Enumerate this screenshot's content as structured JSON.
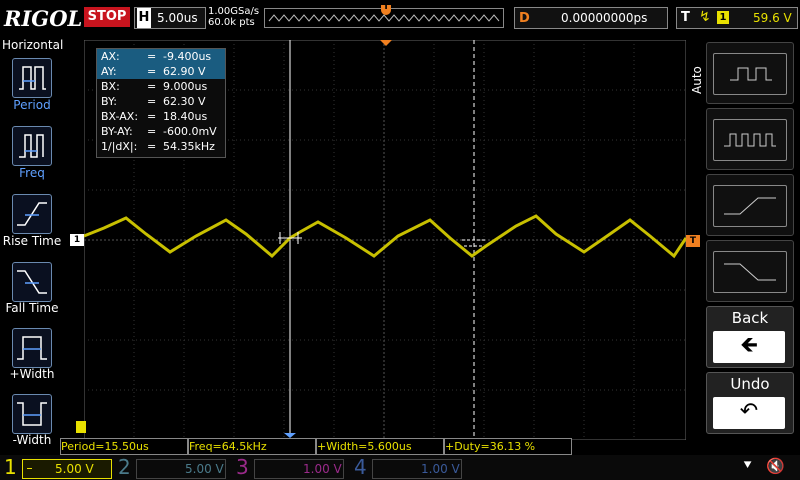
{
  "brand": "RIGOL",
  "run_state": "STOP",
  "horizontal": {
    "letter": "H",
    "timebase": "5.00us",
    "sample_rate": "1.00GSa/s",
    "memory_depth": "60.0k pts"
  },
  "delay": {
    "letter": "D",
    "value": "0.00000000ps"
  },
  "trigger": {
    "letter": "T",
    "source": "1",
    "level": "59.6 V"
  },
  "left_menu": {
    "title": "Horizontal",
    "items": [
      {
        "label": "Period"
      },
      {
        "label": "Freq"
      },
      {
        "label": "Rise Time"
      },
      {
        "label": "Fall Time"
      },
      {
        "label": "+Width"
      },
      {
        "label": "-Width"
      }
    ]
  },
  "cursor_readout": [
    {
      "key": "AX:",
      "eq": "=",
      "value": "-9.400us"
    },
    {
      "key": "AY:",
      "eq": "=",
      "value": "62.90 V"
    },
    {
      "key": "BX:",
      "eq": "=",
      "value": "9.000us"
    },
    {
      "key": "BY:",
      "eq": "=",
      "value": "62.30 V"
    },
    {
      "key": "BX-AX:",
      "eq": "=",
      "value": "18.40us"
    },
    {
      "key": "BY-AY:",
      "eq": "=",
      "value": "-600.0mV"
    },
    {
      "key": "1/|dX|:",
      "eq": "=",
      "value": "54.35kHz"
    }
  ],
  "channel_marker": "1",
  "right_menu": {
    "mode_label": "Auto",
    "back_label": "Back",
    "undo_label": "Undo"
  },
  "measurements": [
    {
      "text": "Period=15.50us"
    },
    {
      "text": "Freq=64.5kHz"
    },
    {
      "text": "+Width=5.600us"
    },
    {
      "text": "+Duty=36.13 %"
    }
  ],
  "channels": [
    {
      "num": "1",
      "scale": "5.00 V",
      "color": "#e8e000"
    },
    {
      "num": "2",
      "scale": "5.00 V",
      "color": "#4a7a8a"
    },
    {
      "num": "3",
      "scale": "1.00 V",
      "color": "#9a2a8a"
    },
    {
      "num": "4",
      "scale": "1.00 V",
      "color": "#3a5a9a"
    }
  ],
  "colors": {
    "ch1": "#e8e000",
    "trigger": "#f08020",
    "stop": "#c8141e",
    "menu_accent": "#5fa0ff"
  }
}
